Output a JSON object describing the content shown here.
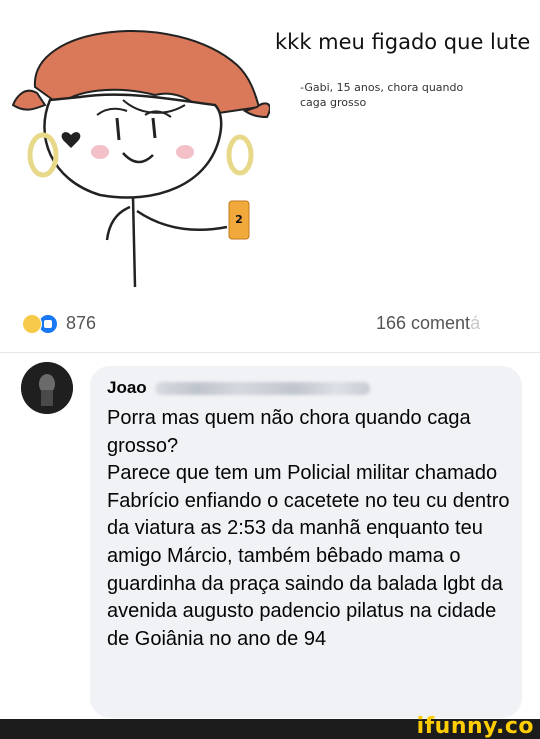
{
  "post": {
    "title": "kkk meu figado que lute",
    "caption_line1": "-Gabi, 15 anos, chora quando",
    "caption_line2": "caga grosso",
    "can_label": "2",
    "reaction_count": "876",
    "comments_count": "166 coment",
    "comments_count_faded": "á"
  },
  "comment": {
    "author": "Joao",
    "body": "Porra mas quem não chora quando caga grosso?\nParece que tem um Policial militar chamado Fabrício enfiando o cacetete no teu cu dentro da viatura as 2:53 da manhã enquanto teu amigo  Márcio, também bêbado mama o guardinha da praça saindo da balada lgbt da avenida augusto padencio pilatus na cidade de Goiânia no ano de 94"
  },
  "watermark": {
    "brand": "ifunny.co"
  },
  "colors": {
    "hair": "#d9795a",
    "earring": "#e8d98a",
    "can": "#f2a93b",
    "like_blue": "#1877f2",
    "bubble": "#f0f2f5",
    "brand_yellow": "#ffcd00"
  },
  "icons": [
    "haha-reaction-icon",
    "like-reaction-icon",
    "avatar"
  ]
}
